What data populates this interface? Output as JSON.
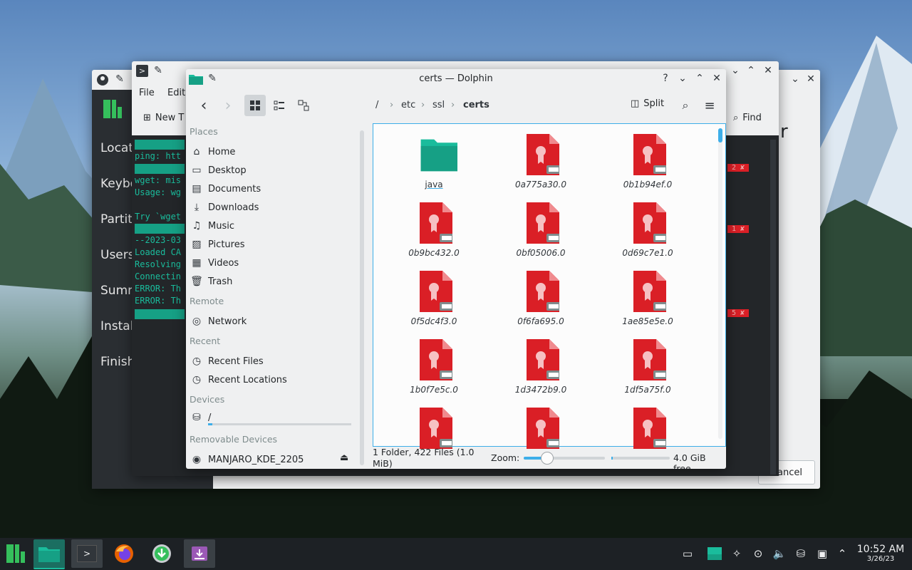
{
  "installer": {
    "sidebar_items": [
      "Locati",
      "Keybo",
      "Partiti",
      "Users",
      "Summ",
      "Install",
      "Finish"
    ],
    "cancel_label": "Cancel",
    "heading_fragment": "r"
  },
  "terminal": {
    "menu": [
      "File",
      "Edit"
    ],
    "new_tab_label": "New T",
    "find_label": "Find",
    "lines": [
      "ping: htt",
      "wget: mis",
      "Usage: wg",
      "",
      "Try `wget",
      "--2023-03",
      "Loaded CA",
      "Resolving",
      "Connectin",
      "ERROR: Th",
      "ERROR: Th"
    ],
    "status_marks": [
      "2 ✘",
      "1 ✘",
      "5 ✘"
    ]
  },
  "dolphin": {
    "title": "certs — Dolphin",
    "split_label": "Split",
    "breadcrumb": [
      "/",
      "etc",
      "ssl",
      "certs"
    ],
    "places": {
      "sections": {
        "places": "Places",
        "remote": "Remote",
        "recent": "Recent",
        "devices": "Devices",
        "removable": "Removable Devices"
      },
      "places_items": [
        {
          "label": "Home",
          "icon": "home-icon"
        },
        {
          "label": "Desktop",
          "icon": "desktop-icon"
        },
        {
          "label": "Documents",
          "icon": "documents-icon"
        },
        {
          "label": "Downloads",
          "icon": "downloads-icon"
        },
        {
          "label": "Music",
          "icon": "music-icon"
        },
        {
          "label": "Pictures",
          "icon": "pictures-icon"
        },
        {
          "label": "Videos",
          "icon": "videos-icon"
        },
        {
          "label": "Trash",
          "icon": "trash-icon"
        }
      ],
      "remote_items": [
        {
          "label": "Network",
          "icon": "network-icon"
        }
      ],
      "recent_items": [
        {
          "label": "Recent Files",
          "icon": "recent-files-icon"
        },
        {
          "label": "Recent Locations",
          "icon": "recent-locations-icon"
        }
      ],
      "device_items": [
        {
          "label": "/",
          "icon": "drive-icon"
        }
      ],
      "removable_items": [
        {
          "label": "MANJARO_KDE_2205",
          "icon": "optical-disc-icon"
        }
      ]
    },
    "files": [
      "java",
      "0a775a30.0",
      "0b1b94ef.0",
      "0b9bc432.0",
      "0bf05006.0",
      "0d69c7e1.0",
      "0f5dc4f3.0",
      "0f6fa695.0",
      "1ae85e5e.0",
      "1b0f7e5c.0",
      "1d3472b9.0",
      "1df5a75f.0",
      "",
      "",
      ""
    ],
    "status_text": "1 Folder, 422 Files (1.0 MiB)",
    "zoom_label": "Zoom:",
    "free_space": "4.0 GiB free"
  },
  "clock": {
    "time": "10:52 AM",
    "date": "3/26/23"
  },
  "colors": {
    "accent": "#3daee9",
    "folder": "#1abc9c",
    "cert": "#da1f26",
    "panel": "#1d2125"
  }
}
